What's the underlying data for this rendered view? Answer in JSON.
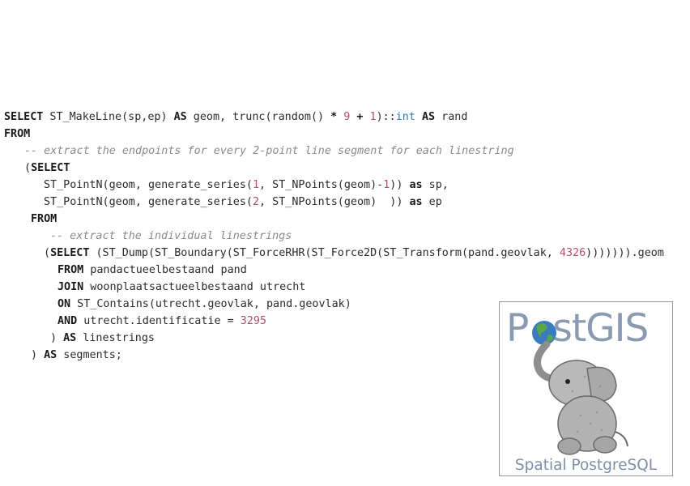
{
  "code_lines": [
    {
      "indent": 0,
      "tokens": [
        {
          "t": "SELECT",
          "c": "kw"
        },
        {
          "t": " ST_MakeLine(sp,ep) ",
          "c": ""
        },
        {
          "t": "AS",
          "c": "kw"
        },
        {
          "t": " geom, trunc(random() ",
          "c": ""
        },
        {
          "t": "*",
          "c": "kw"
        },
        {
          "t": " ",
          "c": ""
        },
        {
          "t": "9",
          "c": "num"
        },
        {
          "t": " ",
          "c": ""
        },
        {
          "t": "+",
          "c": "kw"
        },
        {
          "t": " ",
          "c": ""
        },
        {
          "t": "1",
          "c": "num"
        },
        {
          "t": ")::",
          "c": ""
        },
        {
          "t": "int",
          "c": "typ"
        },
        {
          "t": " ",
          "c": ""
        },
        {
          "t": "AS",
          "c": "kw"
        },
        {
          "t": " rand",
          "c": ""
        }
      ]
    },
    {
      "indent": 0,
      "tokens": [
        {
          "t": "FROM",
          "c": "kw"
        }
      ]
    },
    {
      "indent": 25,
      "tokens": [
        {
          "t": "-- extract the endpoints for every 2-point line segment for each linestring",
          "c": "cmt"
        }
      ]
    },
    {
      "indent": 25,
      "tokens": [
        {
          "t": "(",
          "c": ""
        },
        {
          "t": "SELECT",
          "c": "kw"
        }
      ]
    },
    {
      "indent": 49,
      "tokens": [
        {
          "t": "ST_PointN(geom, generate_series(",
          "c": ""
        },
        {
          "t": "1",
          "c": "num"
        },
        {
          "t": ", ST_NPoints(geom)-",
          "c": ""
        },
        {
          "t": "1",
          "c": "num"
        },
        {
          "t": ")) ",
          "c": ""
        },
        {
          "t": "as",
          "c": "kw"
        },
        {
          "t": " sp,",
          "c": ""
        }
      ]
    },
    {
      "indent": 49,
      "tokens": [
        {
          "t": "ST_PointN(geom, generate_series(",
          "c": ""
        },
        {
          "t": "2",
          "c": "num"
        },
        {
          "t": ", ST_NPoints(geom)  )) ",
          "c": ""
        },
        {
          "t": "as",
          "c": "kw"
        },
        {
          "t": " ep",
          "c": ""
        }
      ]
    },
    {
      "indent": 33,
      "tokens": [
        {
          "t": "FROM",
          "c": "kw"
        }
      ]
    },
    {
      "indent": 57,
      "tokens": [
        {
          "t": "-- extract the individual linestrings",
          "c": "cmt"
        }
      ]
    },
    {
      "indent": 49,
      "tokens": [
        {
          "t": "(",
          "c": ""
        },
        {
          "t": "SELECT",
          "c": "kw"
        },
        {
          "t": " (ST_Dump(ST_Boundary(ST_ForceRHR(ST_Force2D(ST_Transform(pand.geovlak, ",
          "c": ""
        },
        {
          "t": "4326",
          "c": "num"
        },
        {
          "t": "))))))).geom",
          "c": ""
        }
      ]
    },
    {
      "indent": 66,
      "tokens": [
        {
          "t": "FROM",
          "c": "kw"
        },
        {
          "t": " pandactueelbestaand pand",
          "c": ""
        }
      ]
    },
    {
      "indent": 66,
      "tokens": [
        {
          "t": "JOIN",
          "c": "kw"
        },
        {
          "t": " woonplaatsactueelbestaand utrecht",
          "c": ""
        }
      ]
    },
    {
      "indent": 66,
      "tokens": [
        {
          "t": "ON",
          "c": "kw"
        },
        {
          "t": " ST_Contains(utrecht.geovlak, pand.geovlak)",
          "c": ""
        }
      ]
    },
    {
      "indent": 66,
      "tokens": [
        {
          "t": "AND",
          "c": "kw"
        },
        {
          "t": " utrecht.identificatie = ",
          "c": ""
        },
        {
          "t": "3295",
          "c": "num"
        }
      ]
    },
    {
      "indent": 57,
      "tokens": [
        {
          "t": ") ",
          "c": ""
        },
        {
          "t": "AS",
          "c": "kw"
        },
        {
          "t": " linestrings",
          "c": ""
        }
      ]
    },
    {
      "indent": 33,
      "tokens": [
        {
          "t": ") ",
          "c": ""
        },
        {
          "t": "AS",
          "c": "kw"
        },
        {
          "t": " segments;",
          "c": ""
        }
      ]
    }
  ],
  "logo": {
    "title_before": "P",
    "title_after": "stGIS",
    "subtitle": "Spatial PostgreSQL",
    "icon": "postgis-elephant-logo"
  },
  "colors": {
    "keyword": "#1a1a1a",
    "number": "#b0506a",
    "type": "#2a7fb6",
    "comment": "#8a8a8a"
  }
}
